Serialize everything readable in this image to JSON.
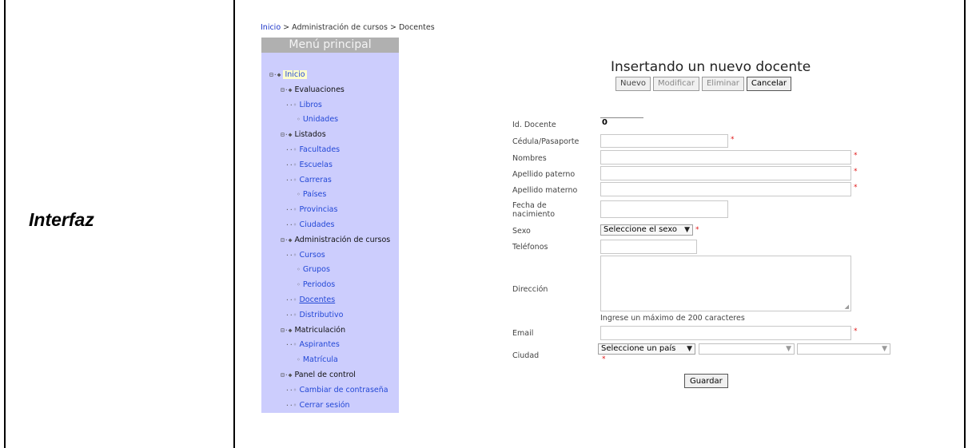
{
  "doc": {
    "row_label": "Interfaz"
  },
  "breadcrumb": {
    "home": "Inicio",
    "separator": " > ",
    "section": "Administración de cursos",
    "page": "Docentes"
  },
  "menu": {
    "title": "Menú principal",
    "items": [
      {
        "label": "Inicio",
        "prefix": "⊟·◆",
        "kind": "home"
      },
      {
        "label": "Evaluaciones",
        "prefix": "⊟·◆",
        "kind": "parent"
      },
      {
        "label": "Libros",
        "prefix": "··◦",
        "kind": "link"
      },
      {
        "label": "Unidades",
        "prefix": "◦",
        "kind": "link"
      },
      {
        "label": "Listados",
        "prefix": "⊟·◆",
        "kind": "parent"
      },
      {
        "label": "Facultades",
        "prefix": "··◦",
        "kind": "link"
      },
      {
        "label": "Escuelas",
        "prefix": "··◦",
        "kind": "link"
      },
      {
        "label": "Carreras",
        "prefix": "··◦",
        "kind": "link"
      },
      {
        "label": "Países",
        "prefix": "◦",
        "kind": "link"
      },
      {
        "label": "Provincias",
        "prefix": "··◦",
        "kind": "link"
      },
      {
        "label": "Ciudades",
        "prefix": "··◦",
        "kind": "link"
      },
      {
        "label": "Administración de cursos",
        "prefix": "⊟·◆",
        "kind": "parent"
      },
      {
        "label": "Cursos",
        "prefix": "··◦",
        "kind": "link"
      },
      {
        "label": "Grupos",
        "prefix": "◦",
        "kind": "link"
      },
      {
        "label": "Periodos",
        "prefix": "◦",
        "kind": "link"
      },
      {
        "label": "Docentes",
        "prefix": "··◦",
        "kind": "current"
      },
      {
        "label": "Distributivo",
        "prefix": "··◦",
        "kind": "link"
      },
      {
        "label": "Matriculación",
        "prefix": "⊟·◆",
        "kind": "parent"
      },
      {
        "label": "Aspirantes",
        "prefix": "··◦",
        "kind": "link"
      },
      {
        "label": "Matrícula",
        "prefix": "◦",
        "kind": "link"
      },
      {
        "label": "Panel de control",
        "prefix": "⊟·◆",
        "kind": "parent"
      },
      {
        "label": "Cambiar de contraseña",
        "prefix": "··◦",
        "kind": "link"
      },
      {
        "label": "Cerrar sesión",
        "prefix": "··◦",
        "kind": "link"
      }
    ]
  },
  "form": {
    "title": "Insertando un nuevo docente",
    "buttons": {
      "new": "Nuevo",
      "edit": "Modificar",
      "delete": "Eliminar",
      "cancel": "Cancelar"
    },
    "labels": {
      "id": "Id. Docente",
      "cedula": "Cédula/Pasaporte",
      "nombres": "Nombres",
      "apellido_paterno": "Apellido paterno",
      "apellido_materno": "Apellido materno",
      "fecha": "Fecha de nacimiento",
      "sexo": "Sexo",
      "telefonos": "Teléfonos",
      "direccion": "Dirección",
      "email": "Email",
      "ciudad": "Ciudad"
    },
    "values": {
      "id": "0",
      "cedula": "",
      "nombres": "",
      "apellido_paterno": "",
      "apellido_materno": "",
      "fecha": "",
      "telefonos": "",
      "direccion": "",
      "email": "",
      "sexo": "Seleccione el sexo",
      "pais": "Seleccione un país",
      "provincia": "",
      "ciudad": ""
    },
    "required_mark": "*",
    "direccion_hint": "Ingrese un máximo de 200 caracteres",
    "save_label": "Guardar"
  },
  "icons": {
    "dropdown": "chevron-down-icon",
    "resize": "resize-grip-icon"
  },
  "colors": {
    "menu_bg": "#cccdfd",
    "menu_header": "#b0b0b0",
    "link": "#2348d6",
    "required": "#e01818"
  }
}
